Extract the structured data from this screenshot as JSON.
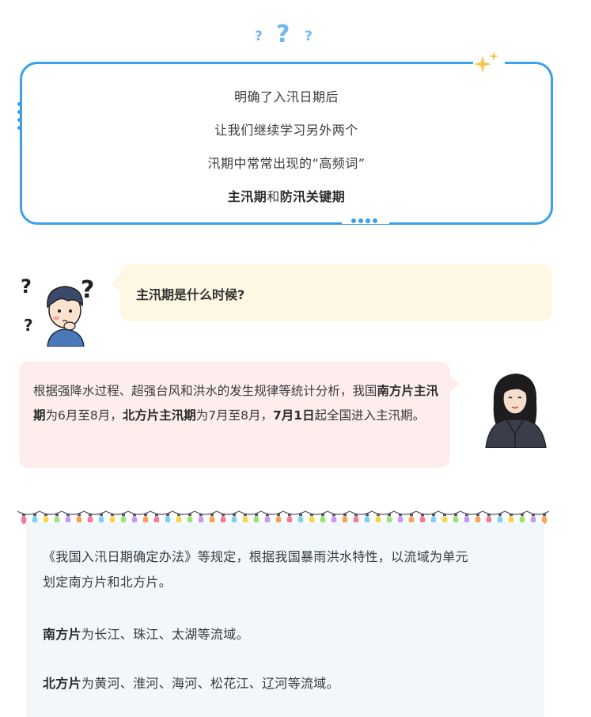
{
  "decor": {
    "question_marks": [
      "?",
      "?",
      "?"
    ],
    "accent_color": "#3aa0ec",
    "sparkle_color": "#f6c445"
  },
  "intro": {
    "line1": "明确了入汛日期后",
    "line2": "让我们继续学习另外两个",
    "line3": "汛期中常常出现的“高频词”",
    "line4_term1": "主汛期",
    "line4_connector": "和",
    "line4_term2": "防汛关键期"
  },
  "question": {
    "text": "主汛期是什么时候?",
    "bubble_color": "#fdf7e4"
  },
  "answer": {
    "part1": "根据强降水过程、超强台风和洪水的发生规律等统计分析，我国",
    "bold1": "南方片主汛期",
    "part2": "为6月至8月，",
    "bold2": "北方片主汛期",
    "part3": "为7月至8月，",
    "bold3": "7月1日",
    "part4": "起全国进入主汛期。",
    "bubble_color": "#fdeeed"
  },
  "info": {
    "line1": "《我国入汛日期确定办法》等规定，根据我国暴雨洪水特性，以流域为单元",
    "line2": "划定南方片和北方片。",
    "south_label": "南方片",
    "south_text": "为长江、珠江、太湖等流域。",
    "north_label": "北方片",
    "north_text": "为黄河、淮河、海河、松花江、辽河等流域。",
    "panel_color": "#f1f7fa"
  }
}
